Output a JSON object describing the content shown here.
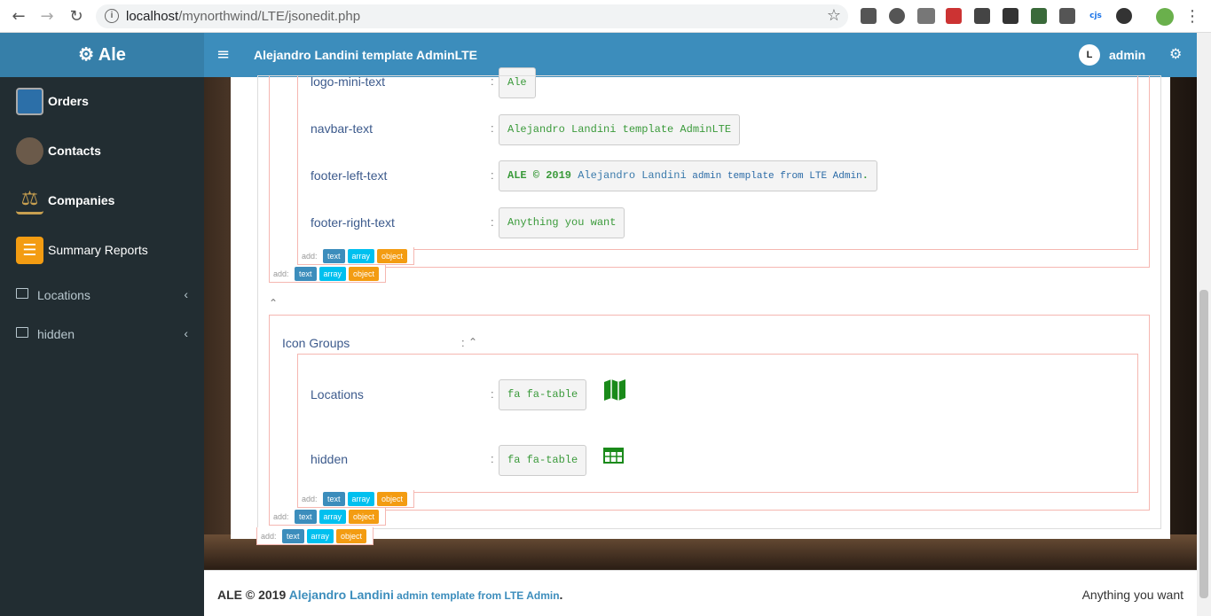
{
  "browser": {
    "url_host": "localhost",
    "url_path": "/mynorthwind/LTE/jsonedit.php"
  },
  "sidebar": {
    "logo": "⚙ Ale",
    "items": [
      {
        "label": "Orders"
      },
      {
        "label": "Contacts"
      },
      {
        "label": "Companies"
      },
      {
        "label": "Summary Reports"
      },
      {
        "label": "Locations"
      },
      {
        "label": "hidden"
      }
    ]
  },
  "navbar": {
    "title": "Alejandro Landini template AdminLTE",
    "user": "admin"
  },
  "editor": {
    "fields": [
      {
        "key": "logo-mini-text",
        "value": "Ale"
      },
      {
        "key": "navbar-text",
        "value": "Alejandro Landini template AdminLTE"
      },
      {
        "key": "footer-left-text",
        "value_a": "ALE © 2019 ",
        "value_b": "Alejandro Landini",
        "value_c": " admin template from LTE Admin",
        "value_d": "."
      },
      {
        "key": "footer-right-text",
        "value": "Anything you want"
      }
    ],
    "add_label": "add:",
    "btn_text": "text",
    "btn_array": "array",
    "btn_object": "object",
    "group_key": "Icon Groups",
    "colon": ":",
    "icon_groups": [
      {
        "key": "Locations",
        "value": "fa fa-table",
        "icon": "map-icon"
      },
      {
        "key": "hidden",
        "value": "fa fa-table",
        "icon": "table-icon"
      }
    ]
  },
  "footer": {
    "left_a": "ALE © 2019 ",
    "left_b": "Alejandro Landini",
    "left_c": " admin template from LTE Admin",
    "left_d": ".",
    "right": "Anything you want"
  },
  "colors": {
    "navbar": "#3c8dbc",
    "logo": "#367fa9",
    "sidebar": "#222d32"
  }
}
